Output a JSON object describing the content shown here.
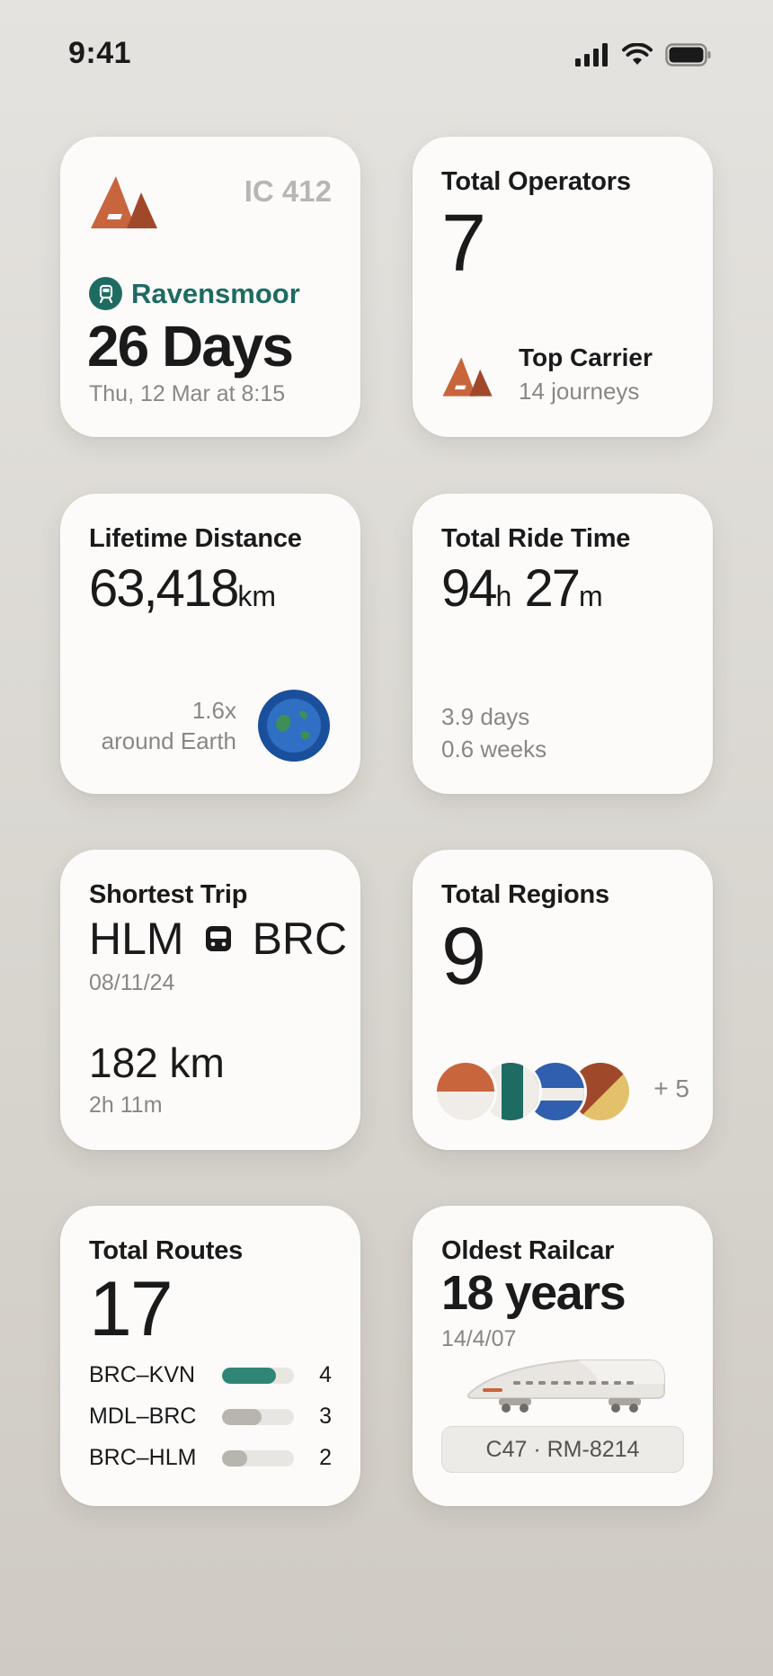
{
  "status_bar": {
    "time": "9:41",
    "icons": [
      "signal-icon",
      "wifi-icon",
      "battery-icon"
    ]
  },
  "colors": {
    "accent_teal": "#1e6b62",
    "brand_orange": "#c8653d",
    "brand_brown": "#a0492a",
    "bar_grey": "#b8b5ae"
  },
  "cards": {
    "next_trip": {
      "train_number": "IC 412",
      "destination": "Ravensmoor",
      "countdown": "26 Days",
      "departure": "Thu, 12 Mar at 8:15"
    },
    "operators": {
      "title": "Total Operators",
      "value": "7",
      "top_carrier_label": "Top Carrier",
      "top_carrier_journeys": "14 journeys"
    },
    "distance": {
      "title": "Lifetime Distance",
      "value": "63,418",
      "unit": "km",
      "earth_multiple": "1.6x",
      "earth_caption": "around Earth"
    },
    "ride_time": {
      "title": "Total Ride Time",
      "hours": "94",
      "hours_unit": "h",
      "minutes": "27",
      "minutes_unit": "m",
      "days": "3.9 days",
      "weeks": "0.6 weeks"
    },
    "shortest_trip": {
      "title": "Shortest Trip",
      "from": "HLM",
      "to": "BRC",
      "date": "08/11/24",
      "distance": "182 km",
      "duration": "2h 11m"
    },
    "regions": {
      "title": "Total Regions",
      "value": "9",
      "more": "+ 5"
    },
    "routes": {
      "title": "Total Routes",
      "value": "17",
      "items": [
        {
          "name": "BRC–KVN",
          "count": "4",
          "fraction": 0.75,
          "color": "#2f8576"
        },
        {
          "name": "MDL–BRC",
          "count": "3",
          "fraction": 0.55,
          "color": "#b8b5ae"
        },
        {
          "name": "BRC–HLM",
          "count": "2",
          "fraction": 0.35,
          "color": "#b8b5ae"
        }
      ]
    },
    "railcar": {
      "title": "Oldest Railcar",
      "age": "18 years",
      "date": "14/4/07",
      "car_id": "C47 · RM-8214"
    }
  }
}
